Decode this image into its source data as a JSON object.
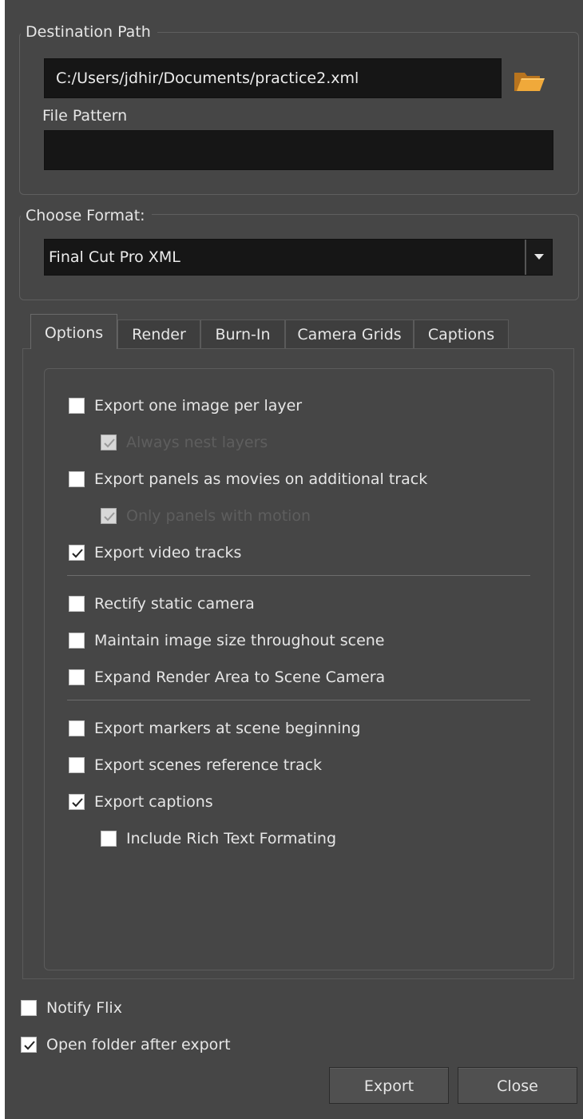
{
  "destination": {
    "group_title": "Destination Path",
    "path_value": "C:/Users/jdhir/Documents/practice2.xml",
    "file_pattern_label": "File Pattern",
    "file_pattern_value": ""
  },
  "format": {
    "group_title": "Choose Format:",
    "selected": "Final Cut Pro XML"
  },
  "tabs": [
    {
      "label": "Options",
      "active": true
    },
    {
      "label": "Render"
    },
    {
      "label": "Burn-In"
    },
    {
      "label": "Camera Grids"
    },
    {
      "label": "Captions"
    }
  ],
  "options": {
    "export_one_image_per_layer": {
      "label": "Export one image per layer",
      "checked": false
    },
    "always_nest_layers": {
      "label": "Always nest layers",
      "checked": true,
      "disabled": true
    },
    "export_panels_as_movies": {
      "label": "Export panels as movies on additional track",
      "checked": false
    },
    "only_panels_with_motion": {
      "label": "Only panels with motion",
      "checked": true,
      "disabled": true
    },
    "export_video_tracks": {
      "label": "Export video tracks",
      "checked": true
    },
    "rectify_static_camera": {
      "label": "Rectify static camera",
      "checked": false
    },
    "maintain_image_size": {
      "label": "Maintain image size throughout scene",
      "checked": false
    },
    "expand_render_area": {
      "label": "Expand Render Area to Scene Camera",
      "checked": false
    },
    "export_markers": {
      "label": "Export markers at scene beginning",
      "checked": false
    },
    "export_scenes_reference": {
      "label": "Export scenes reference track",
      "checked": false
    },
    "export_captions": {
      "label": "Export captions",
      "checked": true
    },
    "include_rich_text": {
      "label": "Include Rich Text Formating",
      "checked": false
    }
  },
  "footer": {
    "notify_flix": {
      "label": "Notify Flix",
      "checked": false
    },
    "open_folder": {
      "label": "Open folder after export",
      "checked": true
    },
    "export_button": "Export",
    "close_button": "Close"
  },
  "icons": {
    "folder": "folder-icon",
    "checkmark": "checkmark-icon",
    "dropdown": "chevron-down-icon"
  },
  "colors": {
    "background": "#464646",
    "field": "#161616",
    "folder": "#e8a23a",
    "text": "#e6e6e6",
    "disabled_text": "#5e5e5e"
  }
}
